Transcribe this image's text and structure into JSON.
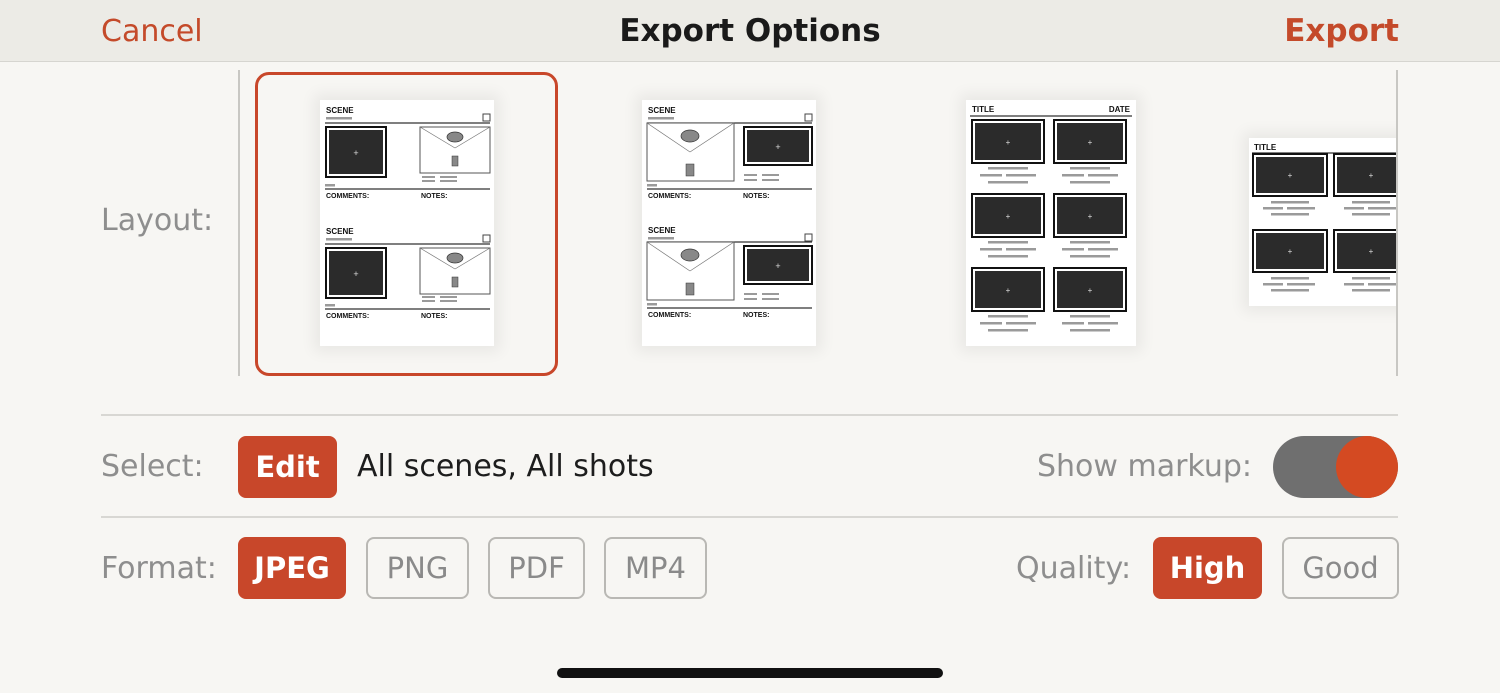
{
  "nav": {
    "cancel": "Cancel",
    "title": "Export Options",
    "export": "Export"
  },
  "layout": {
    "label": "Layout:",
    "selected_index": 0,
    "thumbnails": [
      {
        "name": "two-scene-comments-notes",
        "header_labels": [
          "SCENE",
          "SCENE"
        ],
        "field_labels": [
          "COMMENTS:",
          "NOTES:",
          "COMMENTS:",
          "NOTES:"
        ]
      },
      {
        "name": "two-scene-plan-view",
        "header_labels": [
          "SCENE",
          "SCENE"
        ],
        "field_labels": [
          "COMMENTS:",
          "NOTES:",
          "COMMENTS:",
          "NOTES:"
        ]
      },
      {
        "name": "six-panel-portrait",
        "header_labels": [
          "TITLE",
          "DATE"
        ]
      },
      {
        "name": "four-panel-landscape",
        "header_labels": [
          "TITLE"
        ]
      }
    ]
  },
  "select": {
    "label": "Select:",
    "edit_button": "Edit",
    "value": "All scenes, All shots",
    "show_markup_label": "Show markup:",
    "show_markup_on": true
  },
  "format": {
    "label": "Format:",
    "options": [
      "JPEG",
      "PNG",
      "PDF",
      "MP4"
    ],
    "selected": "JPEG"
  },
  "quality": {
    "label": "Quality:",
    "options": [
      "High",
      "Good"
    ],
    "selected": "High"
  },
  "colors": {
    "accent": "#c8472a",
    "toggle_track": "#6f6f6f"
  }
}
